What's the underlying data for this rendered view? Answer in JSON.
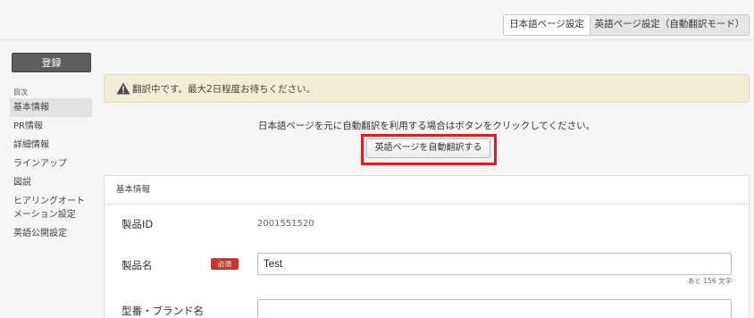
{
  "top_tabs": {
    "japanese": "日本語ページ設定",
    "english": "英語ページ設定（自動翻訳モード）"
  },
  "sidebar": {
    "register_label": "登録",
    "toc_heading": "目次",
    "items": [
      {
        "label": "基本情報"
      },
      {
        "label": "PR情報"
      },
      {
        "label": "詳細情報"
      },
      {
        "label": "ラインアップ"
      },
      {
        "label": "図説"
      },
      {
        "label": "ヒアリングオートメーション設定"
      },
      {
        "label": "英語公開設定"
      }
    ]
  },
  "alert": {
    "icon": "warning-icon",
    "text": "翻訳中です。最大2日程度お待ちください。"
  },
  "auto_translate": {
    "instruction": "日本語ページを元に自動翻訳を利用する場合はボタンをクリックしてください。",
    "button_label": "英語ページを自動翻訳する"
  },
  "basic_info": {
    "title": "基本情報",
    "product_id_label": "製品ID",
    "product_id_value": "2001551520",
    "product_name_label": "製品名",
    "required_badge": "必須",
    "product_name_value": "Test",
    "remaining_chars": "あと 156 文字",
    "model_brand_label": "型番・ブランド名",
    "model_brand_value": ""
  },
  "colors": {
    "alert_bg": "#f3ecd6",
    "highlight": "#e21b23",
    "required_badge": "#c8372d",
    "register_button": "#5e5e5e"
  }
}
